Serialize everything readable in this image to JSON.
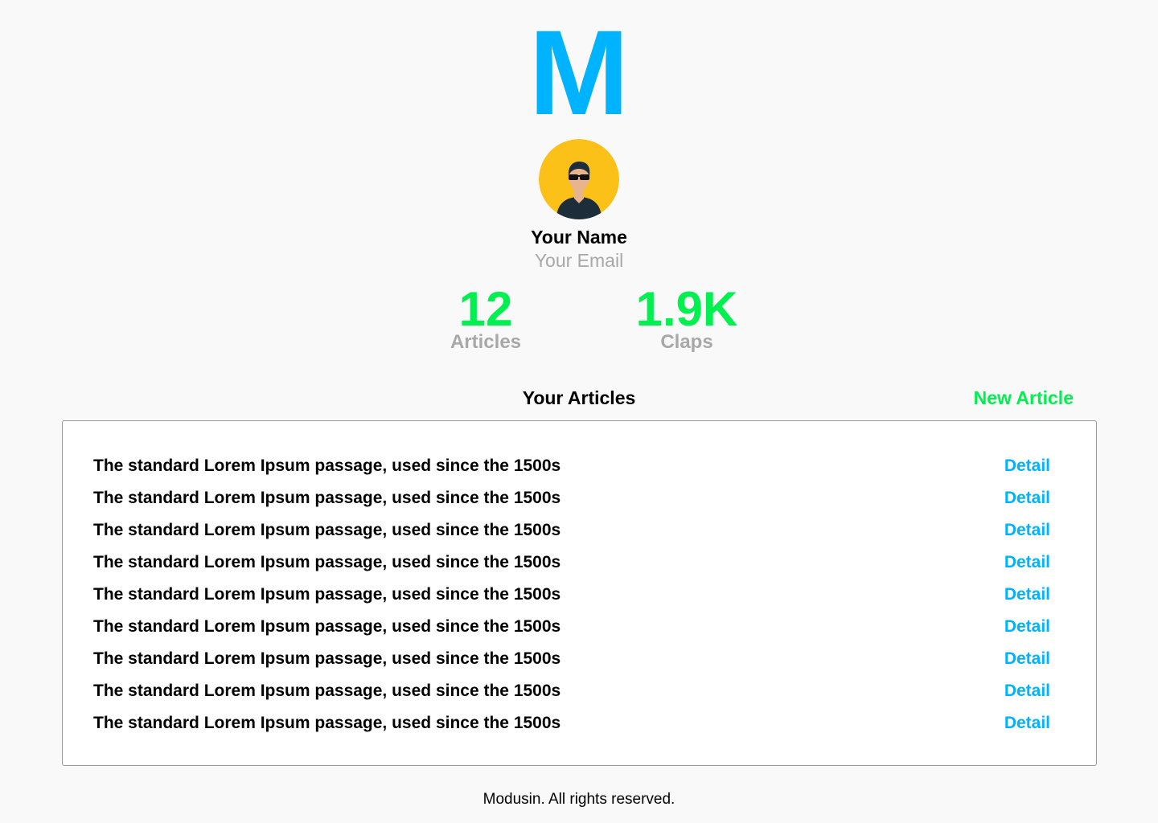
{
  "brand": {
    "logo_letter": "M",
    "logo_color": "#00b3ff"
  },
  "profile": {
    "avatar_icon": "avatar-icon",
    "name": "Your Name",
    "email": "Your Email"
  },
  "stats": [
    {
      "value": "12",
      "label": "Articles"
    },
    {
      "value": "1.9K",
      "label": "Claps"
    }
  ],
  "accent_green": "#00f050",
  "articles_section": {
    "title": "Your Articles",
    "new_label": "New Article",
    "items": [
      {
        "title": "The standard Lorem Ipsum passage, used since the 1500s",
        "action": "Detail"
      },
      {
        "title": "The standard Lorem Ipsum passage, used since the 1500s",
        "action": "Detail"
      },
      {
        "title": "The standard Lorem Ipsum passage, used since the 1500s",
        "action": "Detail"
      },
      {
        "title": "The standard Lorem Ipsum passage, used since the 1500s",
        "action": "Detail"
      },
      {
        "title": "The standard Lorem Ipsum passage, used since the 1500s",
        "action": "Detail"
      },
      {
        "title": "The standard Lorem Ipsum passage, used since the 1500s",
        "action": "Detail"
      },
      {
        "title": "The standard Lorem Ipsum passage, used since the 1500s",
        "action": "Detail"
      },
      {
        "title": "The standard Lorem Ipsum passage, used since the 1500s",
        "action": "Detail"
      },
      {
        "title": "The standard Lorem Ipsum passage, used since the 1500s",
        "action": "Detail"
      }
    ]
  },
  "footer": {
    "text": "Modusin. All rights reserved."
  }
}
